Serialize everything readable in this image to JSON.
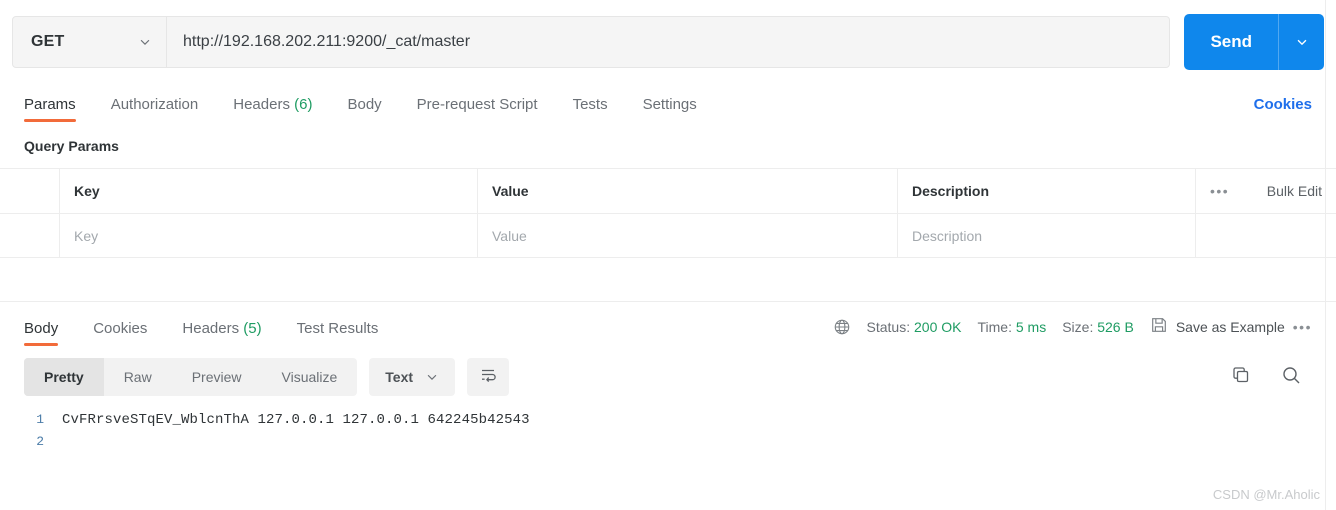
{
  "request": {
    "method": "GET",
    "url": "http://192.168.202.211:9200/_cat/master",
    "send_label": "Send",
    "tabs": [
      {
        "label": "Params",
        "count": "",
        "active": true
      },
      {
        "label": "Authorization",
        "count": "",
        "active": false
      },
      {
        "label": "Headers",
        "count": "(6)",
        "active": false
      },
      {
        "label": "Body",
        "count": "",
        "active": false
      },
      {
        "label": "Pre-request Script",
        "count": "",
        "active": false
      },
      {
        "label": "Tests",
        "count": "",
        "active": false
      },
      {
        "label": "Settings",
        "count": "",
        "active": false
      }
    ],
    "cookies_label": "Cookies",
    "query_params": {
      "section_title": "Query Params",
      "headers": {
        "key": "Key",
        "value": "Value",
        "description": "Description"
      },
      "bulk_edit_label": "Bulk Edit",
      "rows": [
        {
          "key_placeholder": "Key",
          "value_placeholder": "Value",
          "description_placeholder": "Description"
        }
      ]
    }
  },
  "response": {
    "tabs": [
      {
        "label": "Body",
        "count": "",
        "active": true
      },
      {
        "label": "Cookies",
        "count": "",
        "active": false
      },
      {
        "label": "Headers",
        "count": "(5)",
        "active": false
      },
      {
        "label": "Test Results",
        "count": "",
        "active": false
      }
    ],
    "status_label": "Status:",
    "status_value": "200 OK",
    "time_label": "Time:",
    "time_value": "5 ms",
    "size_label": "Size:",
    "size_value": "526 B",
    "save_example_label": "Save as Example",
    "view_modes": [
      {
        "label": "Pretty",
        "active": true
      },
      {
        "label": "Raw",
        "active": false
      },
      {
        "label": "Preview",
        "active": false
      },
      {
        "label": "Visualize",
        "active": false
      }
    ],
    "format_label": "Text",
    "body_lines": [
      {
        "number": "1",
        "text": "CvFRrsveSTqEV_WblcnThA 127.0.0.1 127.0.0.1 642245b42543"
      },
      {
        "number": "2",
        "text": ""
      }
    ]
  },
  "watermark": "CSDN @Mr.Aholic",
  "colors": {
    "accent_orange": "#f26b3a",
    "send_blue": "#0f87ec",
    "link_blue": "#1f6feb",
    "success_green": "#1f9c63"
  }
}
